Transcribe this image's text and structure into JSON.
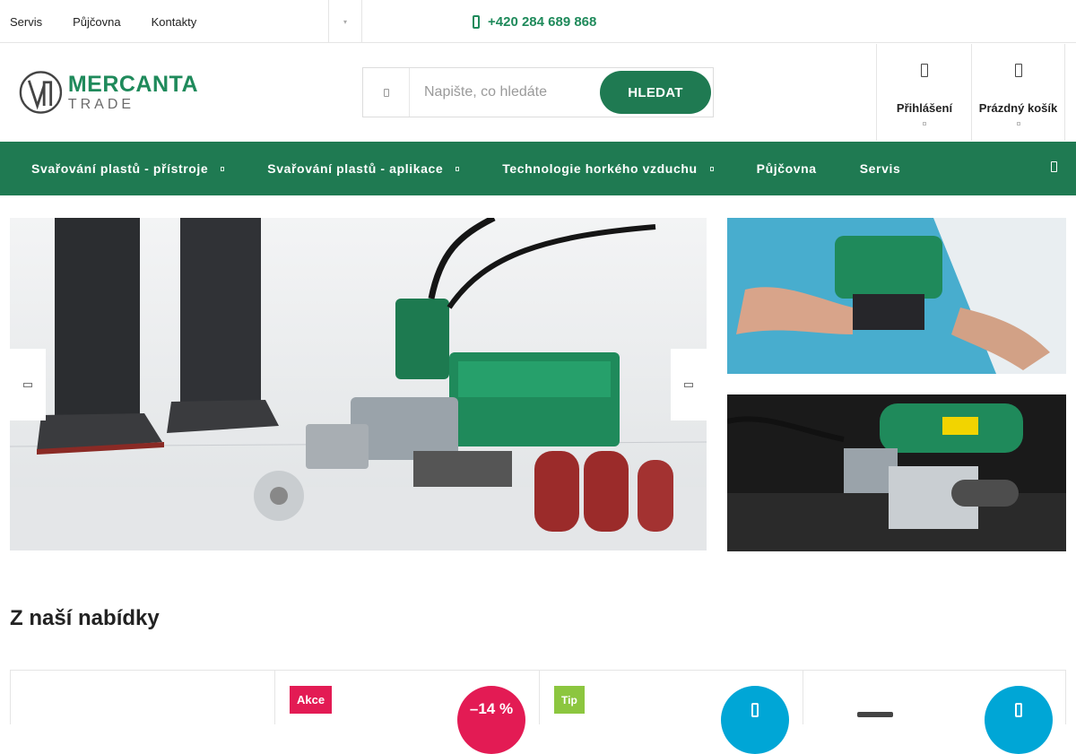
{
  "topbar": {
    "links": [
      "Servis",
      "Půjčovna",
      "Kontakty"
    ],
    "phone": "+420 284 689 868"
  },
  "header": {
    "logo": {
      "name": "MERCANTA",
      "sub": "TRADE"
    },
    "search": {
      "placeholder": "Napište, co hledáte",
      "button_label": "HLEDAT"
    },
    "login_label": "Přihlášení",
    "cart_label": "Prázdný košík"
  },
  "mainnav": {
    "items": [
      {
        "label": "Svařování plastů - přístroje",
        "has_submenu": true
      },
      {
        "label": "Svařování plastů - aplikace",
        "has_submenu": true
      },
      {
        "label": "Technologie horkého vzduchu",
        "has_submenu": true
      },
      {
        "label": "Půjčovna",
        "has_submenu": false
      },
      {
        "label": "Servis",
        "has_submenu": false
      }
    ]
  },
  "offers": {
    "title": "Z naší nabídky",
    "cards": [
      {
        "flag": "",
        "discount": ""
      },
      {
        "flag": "Akce",
        "discount": "–14 %"
      },
      {
        "flag": "Tip",
        "discount": ""
      },
      {
        "flag": "",
        "discount": ""
      }
    ]
  },
  "colors": {
    "brand_green": "#1f7a52",
    "accent_pink": "#e31b54",
    "tip_green": "#8cc63f",
    "cta_blue": "#00a6d6"
  },
  "icons": [
    "phone-icon",
    "search-icon",
    "user-icon",
    "cart-icon",
    "chevron-down-icon",
    "arrow-left-icon",
    "arrow-right-icon",
    "cart-add-icon"
  ]
}
